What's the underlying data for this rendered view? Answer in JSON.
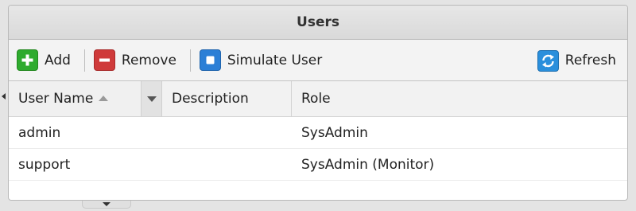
{
  "panel": {
    "title": "Users"
  },
  "toolbar": {
    "add_label": "Add",
    "remove_label": "Remove",
    "simulate_label": "Simulate User",
    "refresh_label": "Refresh",
    "add_color": "#2eab2e",
    "remove_color": "#cf3a3a",
    "simulate_color": "#2b7fd6",
    "refresh_color": "#2a8fdc"
  },
  "grid": {
    "columns": {
      "username": "User Name",
      "description": "Description",
      "role": "Role"
    },
    "sort": {
      "column": "User Name",
      "direction": "ascending"
    },
    "rows": [
      {
        "username": "admin",
        "description": "",
        "role": "SysAdmin"
      },
      {
        "username": "support",
        "description": "",
        "role": "SysAdmin (Monitor)"
      }
    ]
  },
  "icons": {
    "add": "plus-icon",
    "remove": "minus-icon",
    "simulate": "square-icon",
    "refresh": "refresh-icon",
    "sort": "sort-ascending-icon",
    "column_menu": "chevron-down-icon",
    "collapse_left": "chevron-left-icon",
    "collapse_bottom": "chevron-down-icon"
  }
}
